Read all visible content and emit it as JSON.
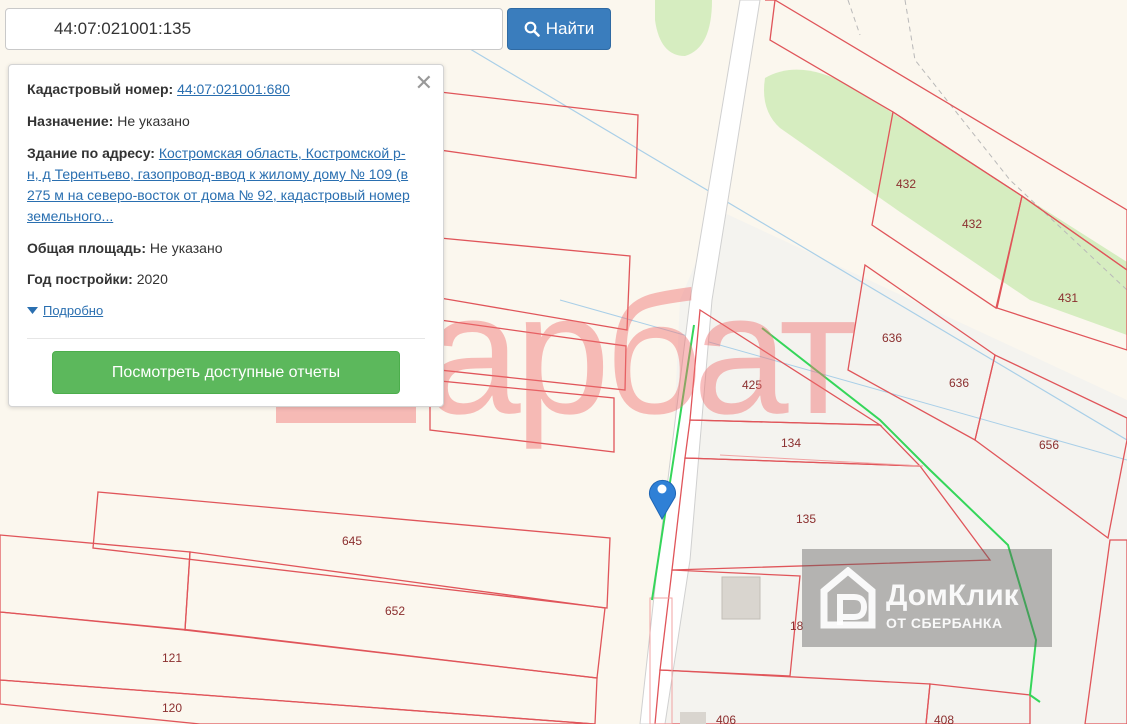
{
  "search": {
    "value": "44:07:021001:135",
    "button_label": "Найти",
    "button_icon": "search-icon"
  },
  "popup": {
    "close_icon": "close-icon",
    "cadastral_label": "Кадастровый номер:",
    "cadastral_value": "44:07:021001:680",
    "purpose_label": "Назначение:",
    "purpose_value": "Не указано",
    "address_label": "Здание по адресу:",
    "address_value": "Костромская область, Костромской р-н, д Терентьево, газопровод-ввод к жилому дому № 109 (в 275 м на северо-восток от дома № 92, кадастровый номер земельного...",
    "area_label": "Общая площадь:",
    "area_value": "Не указано",
    "year_label": "Год постройки:",
    "year_value": "2020",
    "details_label": "Подробно",
    "report_button": "Посмотреть доступные отчеты"
  },
  "map": {
    "parcel_labels": [
      "432",
      "432",
      "431",
      "636",
      "636",
      "656",
      "425",
      "134",
      "135",
      "645",
      "652",
      "121",
      "120",
      "18",
      "406",
      "408"
    ],
    "colors": {
      "background": "#fbf7ee",
      "parcel_border": "#e0555a",
      "green_zone": "#d6edc0",
      "pipeline": "#35d65a",
      "marker": "#2f80d6"
    }
  },
  "watermarks": {
    "arbat_text": "арбат",
    "domclick_name": "ДомКлик",
    "domclick_sub": "ОТ СБЕРБАНКА"
  }
}
